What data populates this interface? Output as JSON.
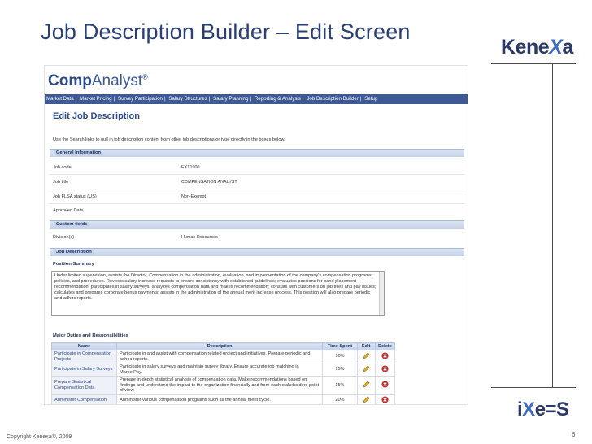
{
  "slide": {
    "title": "Job Description Builder – Edit Screen",
    "logo_top_left": "Kene",
    "logo_top_x": "X",
    "logo_top_right": "a",
    "logo_bottom_i": "i",
    "logo_bottom_x": "X",
    "logo_bottom_rest": "e=S",
    "copyright": "Copyright Kenexa®, 2009",
    "page_number": "6"
  },
  "app": {
    "logo_bold": "Comp",
    "logo_light": "Analyst",
    "logo_mark": "®",
    "nav_items": [
      "Market Data",
      "Market Pricing",
      "Survey Participation",
      "Salary Structures",
      "Salary Planning",
      "Reporting & Analysis",
      "Job Description Builder",
      "Setup"
    ],
    "page_heading": "Edit Job Description",
    "instructions": "Use the Search links to pull in job description content from other job descriptions or type directly in the boxes below."
  },
  "general_information": {
    "section_label": "General Information",
    "fields": [
      {
        "label": "Job code",
        "value": "EXT1000"
      },
      {
        "label": "Job title",
        "value": "COMPENSATION ANALYST"
      },
      {
        "label": "Job FLSA status (US)",
        "value": "Non-Exempt"
      },
      {
        "label": "Approved Date",
        "value": ""
      }
    ]
  },
  "custom_fields": {
    "section_label": "Custom fields",
    "fields": [
      {
        "label": "Division(s)",
        "value": "Human Resources"
      }
    ]
  },
  "job_description": {
    "section_label": "Job Description",
    "summary_heading": "Position Summary",
    "summary_text": "Under limited supervision, assists the Director, Compensation in the administration, evaluation, and implementation of the company's compensation programs, policies, and procedures. Reviews salary increase requests to ensure consistency with established guidelines; evaluates positions for band placement recommendation; participates in salary surveys; analyzes compensation data and makes recommendation; consults with customers on job titles and pay issues; calculates and prepares corporate bonus payments; assists in the administration of the annual merit increase process. This position will also prepare periodic and adhoc reports.",
    "duties_heading": "Major Duties and Responsibilities",
    "duties_columns": [
      "Name",
      "Description",
      "Time Spent",
      "Edit",
      "Delete"
    ],
    "duties": [
      {
        "name": "Participate in Compensation Projects",
        "description": "Participate in and assist with compensation related project and initiatives. Prepare periodic and adhoc reports.",
        "time": "10%"
      },
      {
        "name": "Participate in Salary Surveys",
        "description": "Participate in salary surveys and maintain survey library. Ensure accurate job matching in MarketPay.",
        "time": "15%"
      },
      {
        "name": "Prepare Statistical Compensation Data",
        "description": "Prepare in-depth statistical analysis of compensation data. Make recommendations based on findings and understand the impact to the organization financially and from each stakeholders point of view.",
        "time": "15%"
      },
      {
        "name": "Administer Compensation",
        "description": "Administer various compensation programs such as the annual merit cycle.",
        "time": "20%"
      }
    ]
  },
  "colors": {
    "title": "#2a3f73",
    "nav_bg": "#3d5a94",
    "section_band": "#c4d2ea",
    "edit_icon": "#e6b422",
    "delete_icon": "#c62828"
  }
}
